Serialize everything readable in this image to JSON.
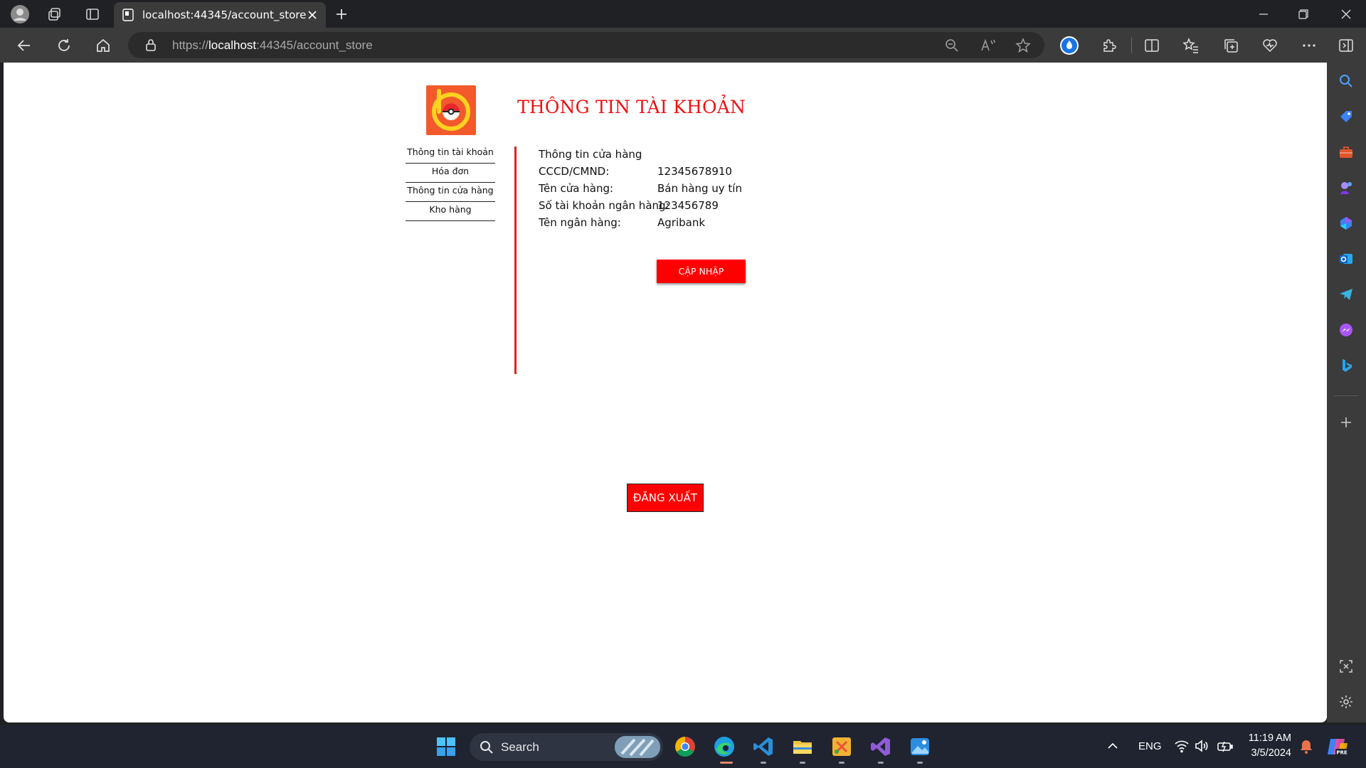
{
  "browser": {
    "tab_title": "localhost:44345/account_store",
    "url_prefix": "https://",
    "url_host": "localhost",
    "url_rest": ":44345/account_store"
  },
  "page": {
    "title": "THÔNG TIN TÀI KHOẢN",
    "nav": [
      "Thông tin tài khoản",
      "Hóa đơn",
      "Thông tin cửa hàng",
      "Kho hàng"
    ],
    "section_title": "Thông tin cửa hàng",
    "fields": [
      {
        "label": "CCCD/CMND:",
        "value": "12345678910"
      },
      {
        "label": "Tên cửa hàng:",
        "value": "Bán hàng uy tín"
      },
      {
        "label": "Số tài khoản ngân hàng:",
        "value": "123456789"
      },
      {
        "label": "Tên ngân hàng:",
        "value": "Agribank"
      }
    ],
    "update_button": "CẬP NHẬP",
    "logout_button": "ĐĂNG XUẤT"
  },
  "taskbar": {
    "search_label": "Search",
    "lang": "ENG",
    "time": "11:19 AM",
    "date": "3/5/2024"
  },
  "colors": {
    "accent_red": "#ff0000",
    "logo_orange": "#f25a2c",
    "chrome_dark": "#202124",
    "chrome_mid": "#3b3b3b"
  }
}
